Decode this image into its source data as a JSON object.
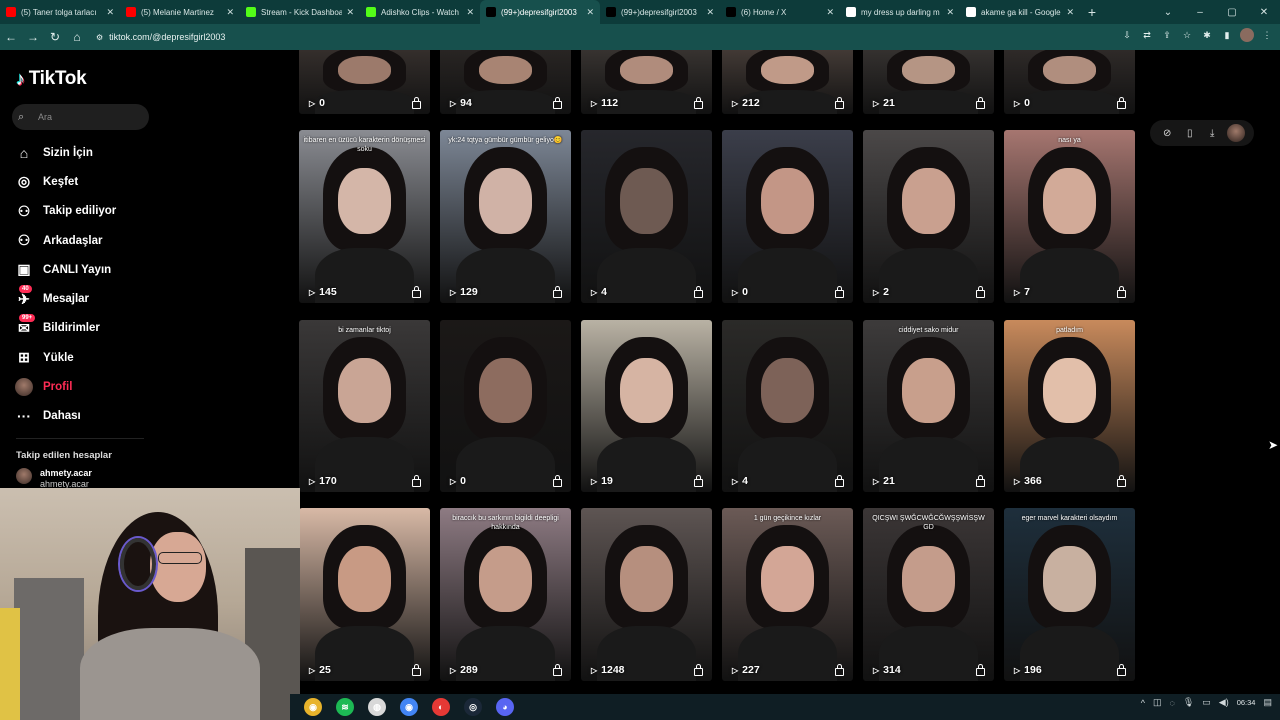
{
  "browser": {
    "tabs": [
      {
        "title": "(5) Taner tolga tarlacı",
        "favicon": "youtube-icon",
        "color": "#ff0000",
        "active": false
      },
      {
        "title": "(5) Melanie Martinez",
        "favicon": "youtube-icon",
        "color": "#ff0000",
        "active": false
      },
      {
        "title": "Stream - Kick Dashboard",
        "favicon": "kick-icon",
        "color": "#53fc18",
        "active": false
      },
      {
        "title": "Adishko Clips - Watch",
        "favicon": "kick-icon",
        "color": "#53fc18",
        "active": false
      },
      {
        "title": "(99+)depresifgirl2003",
        "favicon": "tiktok-icon",
        "color": "#000000",
        "active": true
      },
      {
        "title": "(99+)depresifgirl2003",
        "favicon": "tiktok-icon",
        "color": "#000000",
        "active": false
      },
      {
        "title": "(6) Home / X",
        "favicon": "x-icon",
        "color": "#000000",
        "active": false
      },
      {
        "title": "my dress up darling m",
        "favicon": "google-icon",
        "color": "#ffffff",
        "active": false
      },
      {
        "title": "akame ga kill - Google",
        "favicon": "google-icon",
        "color": "#ffffff",
        "active": false
      }
    ],
    "url": "tiktok.com/@depresifgirl2003"
  },
  "sidebar": {
    "logo": "TikTok",
    "search_placeholder": "Ara",
    "items": [
      {
        "label": "Sizin İçin",
        "icon": "home-icon",
        "glyph": "⌂",
        "badge": ""
      },
      {
        "label": "Keşfet",
        "icon": "compass-icon",
        "glyph": "◎",
        "badge": ""
      },
      {
        "label": "Takip ediliyor",
        "icon": "following-icon",
        "glyph": "⚇",
        "badge": ""
      },
      {
        "label": "Arkadaşlar",
        "icon": "friends-icon",
        "glyph": "⚇",
        "badge": ""
      },
      {
        "label": "CANLI Yayın",
        "icon": "live-icon",
        "glyph": "▣",
        "badge": ""
      },
      {
        "label": "Mesajlar",
        "icon": "messages-icon",
        "glyph": "✈",
        "badge": "40"
      },
      {
        "label": "Bildirimler",
        "icon": "notifications-icon",
        "glyph": "✉",
        "badge": "99+"
      },
      {
        "label": "Yükle",
        "icon": "upload-icon",
        "glyph": "⊞",
        "badge": ""
      },
      {
        "label": "Profil",
        "icon": "profile-icon",
        "glyph": "",
        "badge": ""
      },
      {
        "label": "Dahası",
        "icon": "more-icon",
        "glyph": "···",
        "badge": ""
      }
    ],
    "following_heading": "Takip edilen hesaplar",
    "following": [
      {
        "name": "ahmety.acar",
        "sub": "ahmety.acar"
      }
    ]
  },
  "videos": [
    {
      "views": "0",
      "caption": "",
      "bg": "#3a3330",
      "skin": "#9c7a6b"
    },
    {
      "views": "94",
      "caption": "",
      "bg": "#2c2826",
      "skin": "#a88473"
    },
    {
      "views": "112",
      "caption": "",
      "bg": "#3d3835",
      "skin": "#b08c7c"
    },
    {
      "views": "212",
      "caption": "",
      "bg": "#4a403b",
      "skin": "#c09a88"
    },
    {
      "views": "21",
      "caption": "",
      "bg": "#3a3634",
      "skin": "#b59584"
    },
    {
      "views": "0",
      "caption": "",
      "bg": "#332e2c",
      "skin": "#b08e7e"
    },
    {
      "views": "145",
      "caption": "itibaren en üzücü karakterin dönüşmesi soku",
      "bg": "#8a8c92",
      "skin": "#d4b6a8"
    },
    {
      "views": "129",
      "caption": "yk:24 tqtya gümbür gümbür geliyo😊",
      "bg": "#7d8796",
      "skin": "#d0b2a6"
    },
    {
      "views": "4",
      "caption": "",
      "bg": "#26272c",
      "skin": "#6e5a52"
    },
    {
      "views": "0",
      "caption": "",
      "bg": "#3b3e4a",
      "skin": "#c39686"
    },
    {
      "views": "2",
      "caption": "",
      "bg": "#4b4848",
      "skin": "#c9a08f"
    },
    {
      "views": "7",
      "caption": "nası ya",
      "bg": "#a67670",
      "skin": "#d2aa98"
    },
    {
      "views": "170",
      "caption": "bi zamanlar tiktoj",
      "bg": "#3a3838",
      "skin": "#c9a595"
    },
    {
      "views": "0",
      "caption": "",
      "bg": "#1b1817",
      "skin": "#8d6c5f"
    },
    {
      "views": "19",
      "caption": "",
      "bg": "#b9b2a4",
      "skin": "#d6b4a3"
    },
    {
      "views": "4",
      "caption": "",
      "bg": "#2b2a28",
      "skin": "#7d6258"
    },
    {
      "views": "21",
      "caption": "ciddiyet sako midur",
      "bg": "#3d3b3b",
      "skin": "#c89f8c"
    },
    {
      "views": "366",
      "caption": "patladım",
      "bg": "#c88a5c",
      "skin": "#e2bfaa"
    },
    {
      "views": "25",
      "caption": "",
      "bg": "#d8b9a6",
      "skin": "#c89a84"
    },
    {
      "views": "289",
      "caption": "biraccık bu sarkının bigildi deepligi hakkında",
      "bg": "#8e7b83",
      "skin": "#c59c8a"
    },
    {
      "views": "1248",
      "caption": "",
      "bg": "#5e5553",
      "skin": "#b68f7e"
    },
    {
      "views": "227",
      "caption": "1 gün geçikince kızlar",
      "bg": "#6b5a56",
      "skin": "#d3a696"
    },
    {
      "views": "314",
      "caption": "QICŞWI ŞWĞCWĞCĞWŞŞWİSŞW GD",
      "bg": "#3b3636",
      "skin": "#c49c8b"
    },
    {
      "views": "196",
      "caption": "eger marvel karakteri olsaydım",
      "bg": "#1e2f3c",
      "skin": "#c8b0a0"
    }
  ],
  "taskbar": {
    "apps": [
      {
        "icon": "chrome-icon",
        "glyph": "◉",
        "color": "#e8b32b"
      },
      {
        "icon": "spotify-icon",
        "glyph": "≋",
        "color": "#1db954"
      },
      {
        "icon": "obs-icon",
        "glyph": "◍",
        "color": "#d8d8d8"
      },
      {
        "icon": "chrome-alt-icon",
        "glyph": "◉",
        "color": "#4285f4"
      },
      {
        "icon": "app-icon",
        "glyph": "◐",
        "color": "#e53935"
      },
      {
        "icon": "steam-icon",
        "glyph": "◎",
        "color": "#1b2838"
      },
      {
        "icon": "discord-icon",
        "glyph": "◕",
        "color": "#5865f2"
      }
    ],
    "time": "06:34"
  }
}
